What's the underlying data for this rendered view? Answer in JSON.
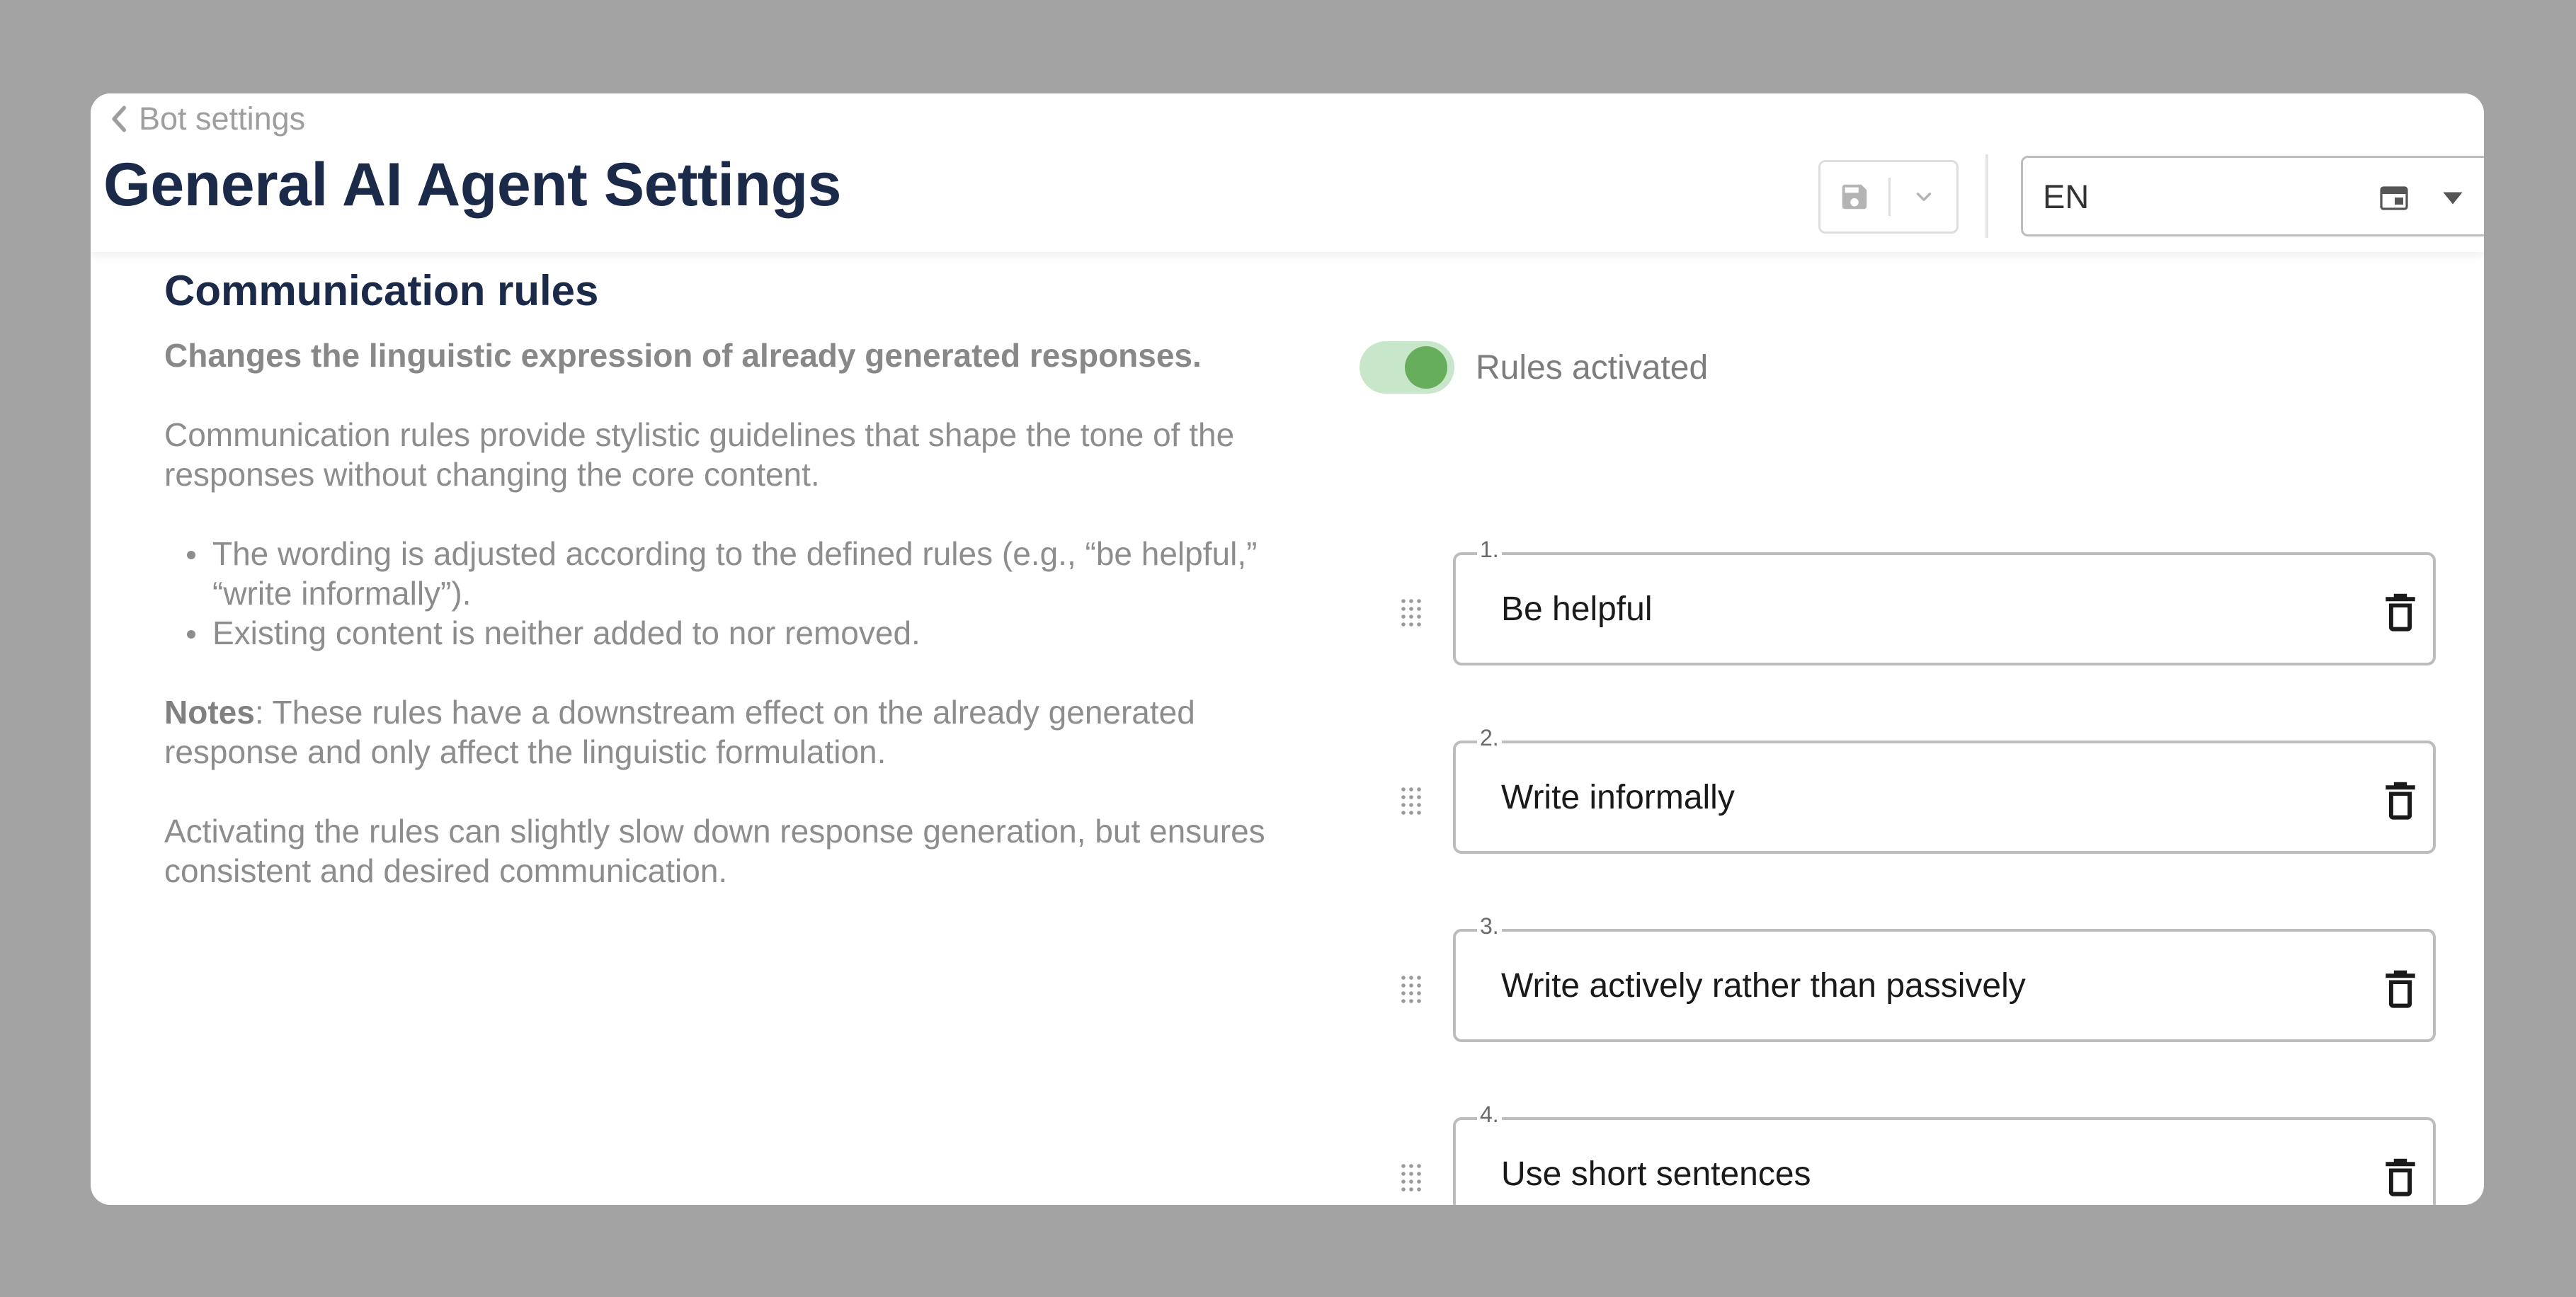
{
  "header": {
    "back_label": "Bot settings",
    "title": "General AI Agent Settings",
    "save_icon": "save-icon",
    "dropdown_icon": "chevron-down-icon",
    "language": {
      "value": "EN",
      "icon": "translation-icon",
      "caret": "caret-down-icon"
    }
  },
  "section": {
    "title": "Communication rules",
    "lead": "Changes the linguistic expression of already generated responses.",
    "intro": "Communication rules provide stylistic guidelines that shape the tone of the responses without changing the core content.",
    "bullets": [
      "The wording is adjusted according to the defined rules (e.g., “be helpful,” “write informally”).",
      "Existing content is neither added to nor removed."
    ],
    "notes_label": "Notes",
    "notes_text": ": These rules have a downstream effect on the already generated response and only affect the linguistic formulation.",
    "outro": "Activating the rules can slightly slow down response generation, but ensures consistent and desired communication."
  },
  "toggle": {
    "label": "Rules activated",
    "on": true,
    "track_color": "#c8e6c9",
    "thumb_color": "#66ad5c"
  },
  "rules": [
    {
      "number": "1.",
      "text": "Be helpful"
    },
    {
      "number": "2.",
      "text": "Write informally"
    },
    {
      "number": "3.",
      "text": "Write actively rather than passively"
    },
    {
      "number": "4.",
      "text": "Use short sentences"
    }
  ],
  "colors": {
    "backdrop": "#a4a3a4",
    "title": "#1c2a4a",
    "muted_text": "#8d8d8d",
    "field_border": "#bdbdbd",
    "accent_green": "#66ad5c"
  }
}
